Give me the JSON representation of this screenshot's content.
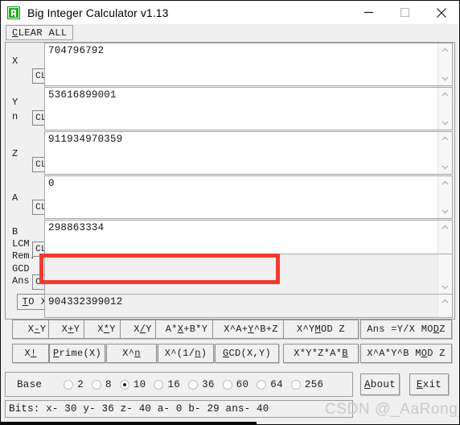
{
  "window": {
    "title": "Big Integer Calculator v1.13",
    "icon": "app-icon",
    "minimize": "—",
    "maximize": "□",
    "close": "✕"
  },
  "menubar": {
    "clear_all": {
      "mnemonic": "C",
      "rest": "LEAR ALL"
    }
  },
  "fields": [
    {
      "key": "x",
      "label": "X",
      "label2": "",
      "label3": "",
      "clear": "CL",
      "value": "704796792",
      "readonly": false
    },
    {
      "key": "y",
      "label": "Y",
      "label2": "n",
      "label3": "",
      "clear": "CL",
      "value": "53616899001",
      "readonly": false
    },
    {
      "key": "z",
      "label": "Z",
      "label2": "",
      "label3": "",
      "clear": "CL",
      "value": "911934970359",
      "readonly": false
    },
    {
      "key": "a",
      "label": "A",
      "label2": "",
      "label3": "",
      "clear": "CL",
      "value": "0",
      "readonly": false
    },
    {
      "key": "b",
      "label": "B",
      "label2": "LCM",
      "label3": "Rem.",
      "clear": "CL",
      "value": "298863334",
      "readonly": false
    },
    {
      "key": "ans",
      "label": "GCD",
      "label2": "Ans",
      "label3": "",
      "clear": "CL",
      "value": "904332399012",
      "readonly": true
    }
  ],
  "to_x_button": {
    "mnemonic": "T",
    "rest": "O X"
  },
  "operations_row1": [
    {
      "pre": "X",
      "mnemonic": "-",
      "post": "Y"
    },
    {
      "pre": "X",
      "mnemonic": "+",
      "post": "Y"
    },
    {
      "pre": "X",
      "mnemonic": "*",
      "post": "Y"
    },
    {
      "pre": "X",
      "mnemonic": "/",
      "post": "Y"
    },
    {
      "pre": "A*",
      "mnemonic": "X",
      "post": "+B*Y"
    },
    {
      "pre": "X^A+",
      "mnemonic": "Y",
      "post": "^B+Z"
    },
    {
      "pre": "X^Y ",
      "mnemonic": "M",
      "post": "OD Z"
    },
    {
      "pre": "Ans =Y/X MO",
      "mnemonic": "D",
      "post": " Z"
    }
  ],
  "operations_row2": [
    {
      "pre": "X ",
      "mnemonic": "!",
      "post": ""
    },
    {
      "pre": "",
      "mnemonic": "P",
      "post": "rime(X)"
    },
    {
      "pre": "X^",
      "mnemonic": "n",
      "post": ""
    },
    {
      "pre": "X^(1/",
      "mnemonic": "n",
      "post": ")"
    },
    {
      "pre": "",
      "mnemonic": "G",
      "post": "CD(X,Y)"
    },
    {
      "pre": "X*Y*Z*A*",
      "mnemonic": "B",
      "post": ""
    },
    {
      "pre": "X^A*Y^B M",
      "mnemonic": "O",
      "post": "D Z"
    }
  ],
  "base": {
    "label": "Base",
    "options": [
      "2",
      "8",
      "10",
      "16",
      "36",
      "60",
      "64",
      "256"
    ],
    "selected": "10"
  },
  "side_buttons": [
    {
      "name": "about",
      "mnemonic": "A",
      "rest": "bout"
    },
    {
      "name": "exit",
      "mnemonic": "E",
      "rest": "xit"
    }
  ],
  "status": {
    "text": "Bits: x- 30 y- 36 z- 40 a- 0 b- 29 ans- 40"
  },
  "watermark": "CSDN @_AaRong_",
  "colors": {
    "highlight": "#f23b30",
    "icon_green": "#13b013",
    "window_bg": "#f0f0f0"
  }
}
